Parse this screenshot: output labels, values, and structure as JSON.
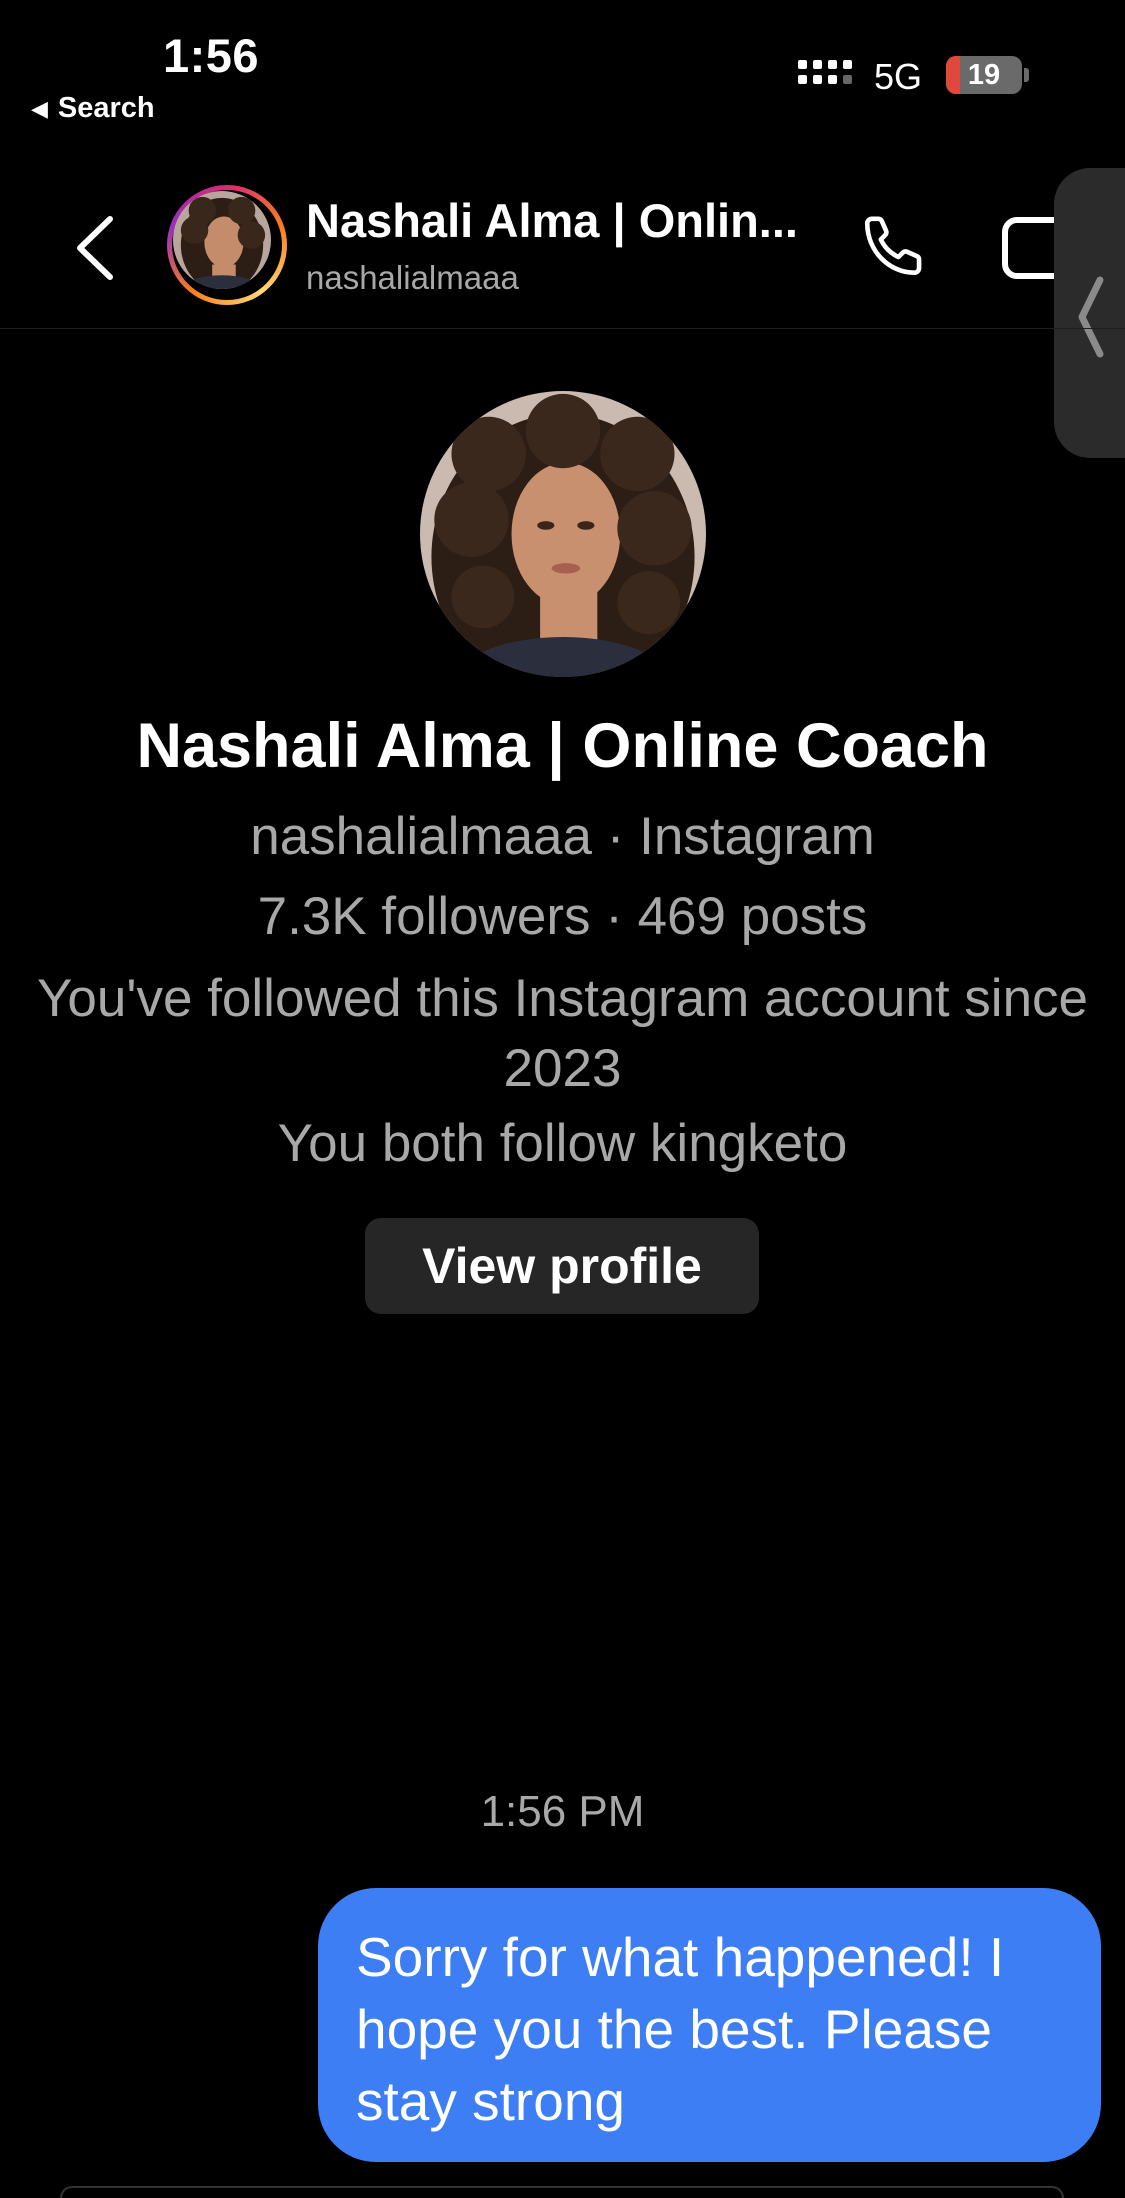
{
  "status_bar": {
    "time": "1:56",
    "back_to_app": "Search",
    "network": "5G",
    "battery_level": "19",
    "battery_fraction": 0.19
  },
  "header": {
    "name": "Nashali Alma | Onlin...",
    "username": "nashalialmaaa",
    "icons": [
      "chevron-left-icon",
      "phone-icon",
      "video-camera-icon"
    ]
  },
  "profile": {
    "name": "Nashali Alma | Online Coach",
    "source": "nashalialmaaa · Instagram",
    "stats": "7.3K followers · 469 posts",
    "follow_since": "You've followed this Instagram account since 2023",
    "mutual": "You both follow kingketo",
    "view_profile_label": "View profile"
  },
  "messages": [
    {
      "timestamp": "1:56 PM",
      "text": "Sorry for what happened! I hope you the best. Please stay strong",
      "sender": "me"
    }
  ],
  "colors": {
    "background": "#000000",
    "bubble_outgoing": "#3d7ef5",
    "secondary_text": "#a8a8a8",
    "button_bg": "#262626"
  }
}
